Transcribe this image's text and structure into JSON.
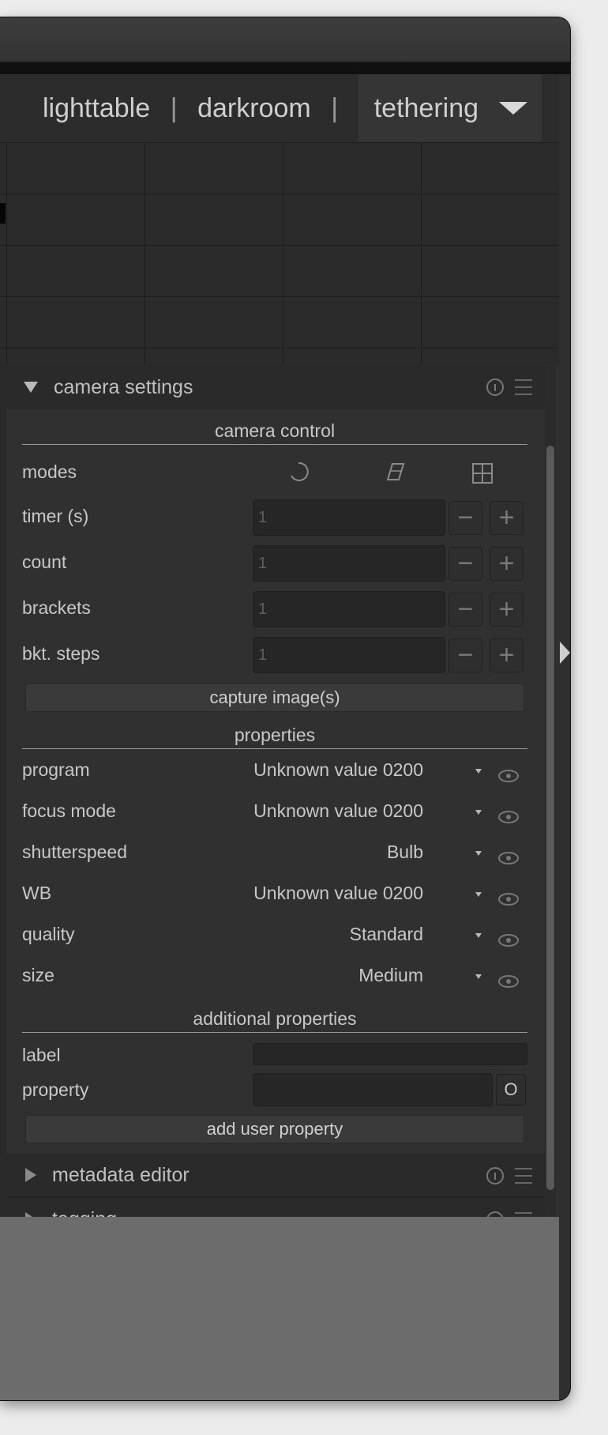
{
  "header": {
    "views": [
      {
        "label": "lighttable"
      },
      {
        "label": "darkroom"
      },
      {
        "label": "tethering"
      }
    ],
    "separator": "|",
    "active_view": "tethering"
  },
  "camera_settings": {
    "title": "camera settings",
    "camera_control": {
      "heading": "camera control",
      "modes_label": "modes",
      "mode_icons": [
        "timer-mode-icon",
        "brackets-mode-icon",
        "sequence-mode-icon"
      ],
      "rows": [
        {
          "label": "timer (s)",
          "value": "1"
        },
        {
          "label": "count",
          "value": "1"
        },
        {
          "label": "brackets",
          "value": "1"
        },
        {
          "label": "bkt. steps",
          "value": "1"
        }
      ],
      "minus": "−",
      "plus": "+",
      "capture_button": "capture image(s)"
    },
    "properties": {
      "heading": "properties",
      "items": [
        {
          "label": "program",
          "value": "Unknown value 0200"
        },
        {
          "label": "focus mode",
          "value": "Unknown value 0200"
        },
        {
          "label": "shutterspeed",
          "value": "Bulb"
        },
        {
          "label": "WB",
          "value": "Unknown value 0200"
        },
        {
          "label": "quality",
          "value": "Standard"
        },
        {
          "label": "size",
          "value": "Medium"
        }
      ]
    },
    "additional_properties": {
      "heading": "additional properties",
      "label_field": {
        "label": "label",
        "value": ""
      },
      "property_field": {
        "label": "property",
        "value": ""
      },
      "o_button": "O",
      "add_button": "add user property"
    }
  },
  "metadata_editor": {
    "title": "metadata editor"
  },
  "tagging": {
    "title": "tagging"
  },
  "colors": {
    "panel_bg": "#303030",
    "header_bg": "#2a2a2a",
    "bottom_bg": "#6c6c6c"
  }
}
